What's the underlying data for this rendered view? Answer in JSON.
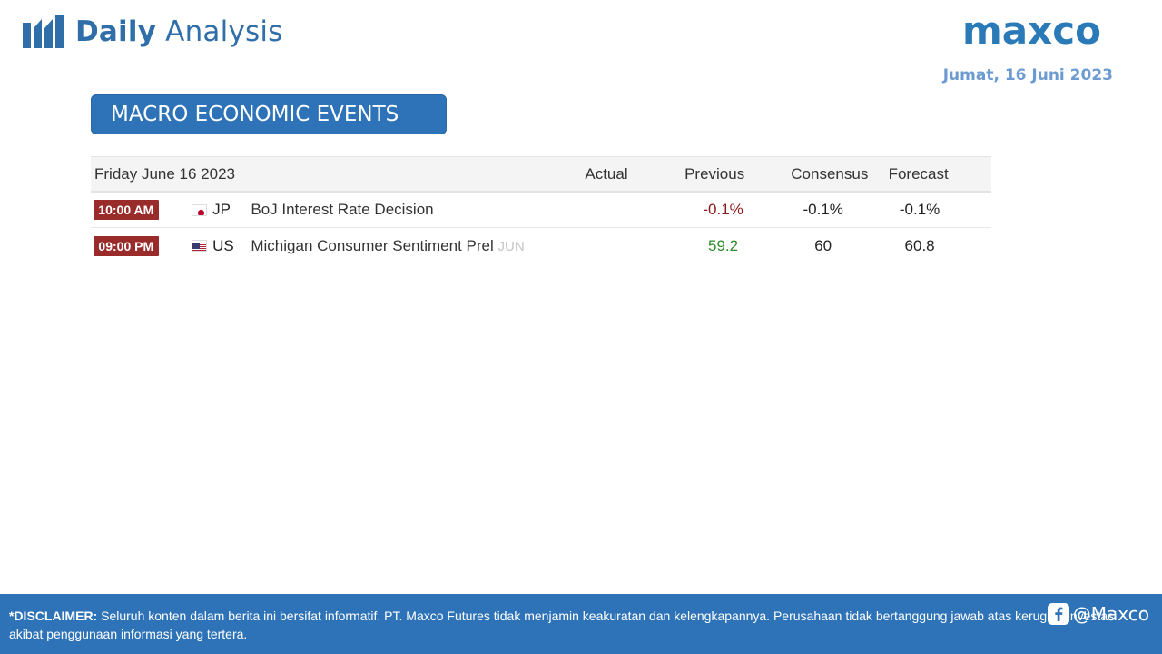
{
  "header": {
    "brand_bold": "Daily",
    "brand_light": " Analysis",
    "logo_text": "maxco",
    "date": "Jumat, 16 Juni 2023",
    "brand_color": "#2f6ea8"
  },
  "section": {
    "title": "MACRO ECONOMIC EVENTS"
  },
  "calendar": {
    "columns": {
      "date": "Friday June 16 2023",
      "actual": "Actual",
      "previous": "Previous",
      "consensus": "Consensus",
      "forecast": "Forecast"
    },
    "rows": [
      {
        "time": "10:00 AM",
        "flag_icon": "japan-flag-icon",
        "country": "JP",
        "event": "BoJ Interest Rate Decision",
        "period": "",
        "actual": "",
        "previous": "-0.1%",
        "consensus": "-0.1%",
        "forecast": "-0.1%"
      },
      {
        "time": "09:00 PM",
        "flag_icon": "usa-flag-icon",
        "country": "US",
        "event": "Michigan Consumer Sentiment Prel",
        "period": "JUN",
        "actual": "",
        "previous": "59.2",
        "consensus": "60",
        "forecast": "60.8"
      }
    ]
  },
  "footer": {
    "disclaimer_label": "*DISCLAIMER:",
    "disclaimer_text": " Seluruh konten dalam berita ini bersifat informatif. PT. Maxco Futures tidak menjamin keakuratan dan kelengkapannya. Perusahaan tidak bertanggung jawab atas kerugian investasi akibat penggunaan informasi yang tertera.",
    "social_handle": "@Maxco",
    "social_icon": "facebook-icon"
  },
  "colors": {
    "accent_blue": "#2e73b8",
    "time_badge": "#9a2b2b",
    "negative": "#8b1a1a",
    "positive": "#2d8b2d"
  }
}
